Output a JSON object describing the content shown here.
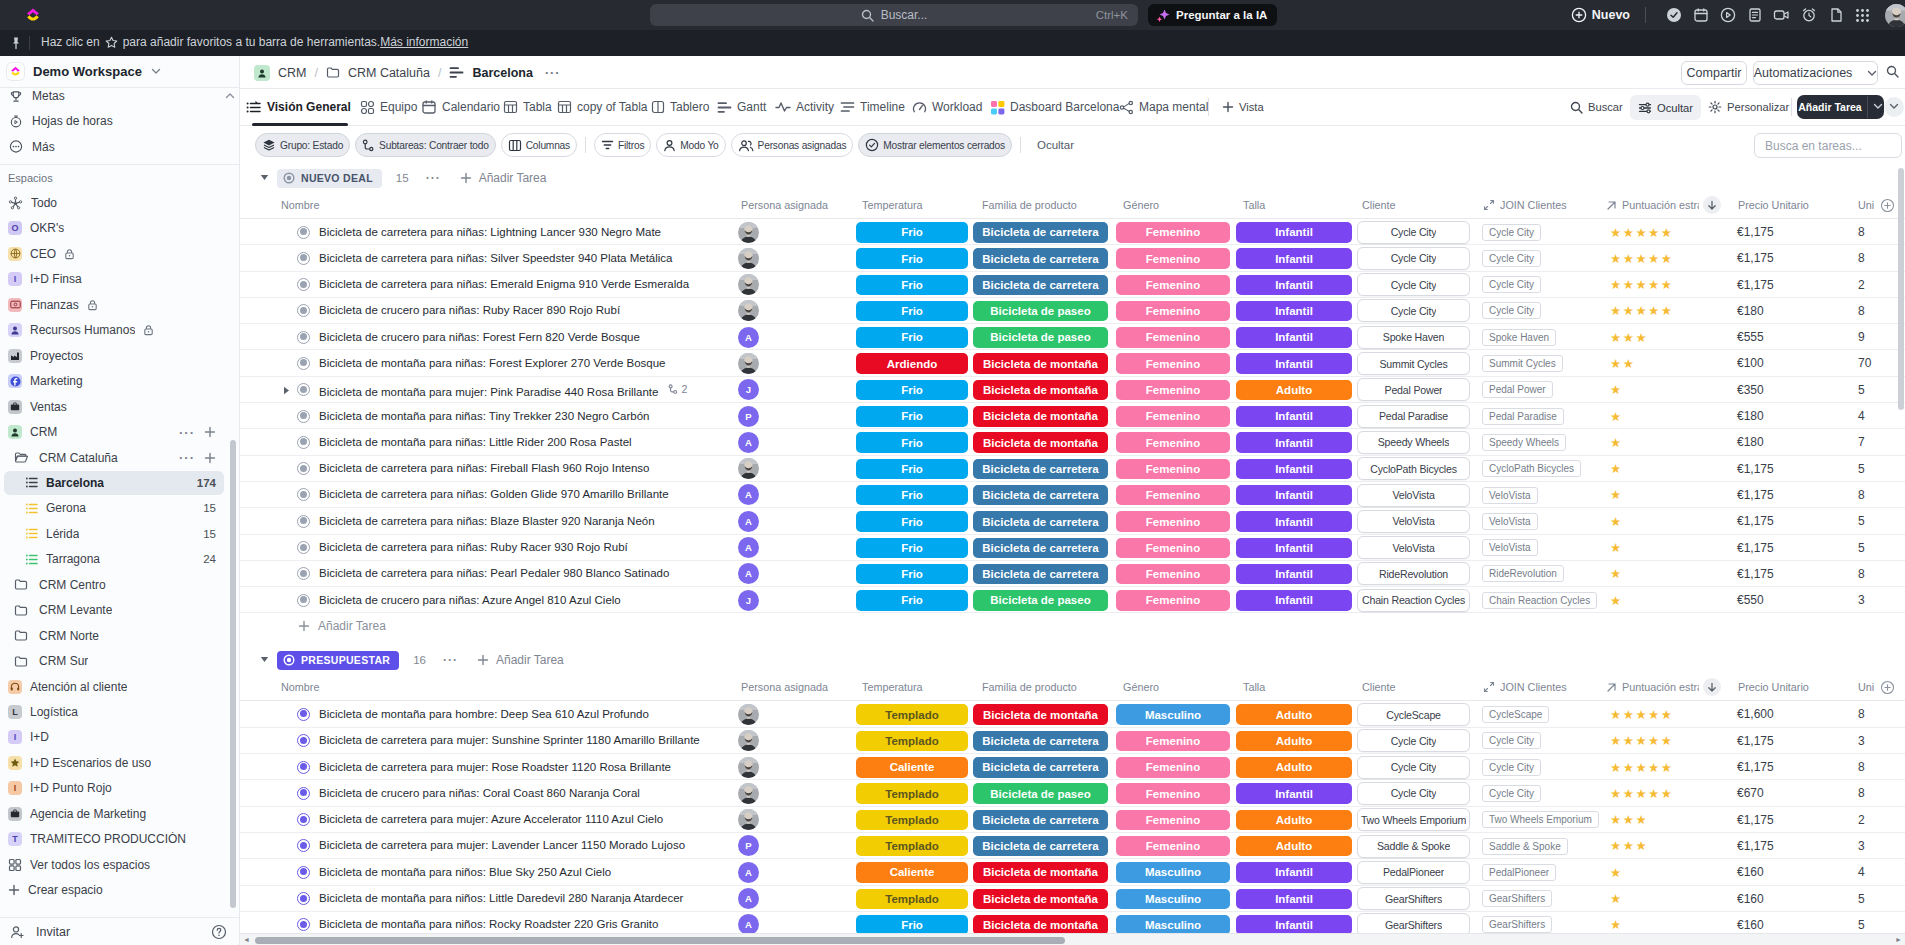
{
  "topbar": {
    "search_placeholder": "Buscar...",
    "search_shortcut": "Ctrl+K",
    "ask_ai_label": "Preguntar a la IA",
    "new_label": "Nuevo",
    "icons": [
      "check-circle-icon",
      "calendar-icon",
      "play-circle-icon",
      "notes-icon",
      "video-icon",
      "alarm-icon",
      "doc-icon",
      "apps-grid-icon",
      "avatar"
    ]
  },
  "favorites_bar": {
    "text_before_star": "Haz clic en",
    "text_after_star": "para añadir favoritos a tu barra de herramientas.",
    "link": "Más información"
  },
  "sidebar": {
    "workspace_name": "Demo Workspace",
    "nav": [
      {
        "label": "Metas",
        "icon": "trophy-icon"
      },
      {
        "label": "Hojas de horas",
        "icon": "stopwatch-icon"
      },
      {
        "label": "Más",
        "icon": "circle-ellipsis-icon"
      }
    ],
    "section_label": "Espacios",
    "items": [
      {
        "label": "Todo",
        "type": "space",
        "icon": "everything-icon"
      },
      {
        "label": "OKR's",
        "type": "space",
        "avatar": "O",
        "bg": "#cfc9f3",
        "fg": "#4f3fae"
      },
      {
        "label": "CEO",
        "type": "space",
        "avatar": "globe",
        "bg": "#f6dfa9",
        "fg": "#8a6a14",
        "lock": true
      },
      {
        "label": "I+D Finsa",
        "type": "space",
        "avatar": "I",
        "bg": "#d4cbf6",
        "fg": "#5a47c2"
      },
      {
        "label": "Finanzas",
        "type": "space",
        "avatar": "banknote",
        "bg": "#f2b9bd",
        "fg": "#8d2730",
        "lock": true
      },
      {
        "label": "Recursos Humanos",
        "type": "space",
        "avatar": "person",
        "bg": "#d6d2f8",
        "fg": "#3f3c8f",
        "lock": true
      },
      {
        "label": "Proyectos",
        "type": "space",
        "avatar": "factory",
        "bg": "#c7cacf",
        "fg": "#21242a"
      },
      {
        "label": "Marketing",
        "type": "space",
        "avatar": "fcircle",
        "bg": "#c9cdf9",
        "fg": "#3e4ed6"
      },
      {
        "label": "Ventas",
        "type": "space",
        "avatar": "briefcase",
        "bg": "#c3c6cb",
        "fg": "#26292f"
      },
      {
        "label": "CRM",
        "type": "space",
        "avatar": "person",
        "bg": "#bfe8cd",
        "fg": "#1f3a2c",
        "actions": true
      },
      {
        "label": "CRM Cataluña",
        "type": "folder",
        "icon": "folder-open-icon",
        "actions": true
      },
      {
        "label": "Barcelona",
        "type": "list",
        "icon": "list-icon",
        "icon_color": "#383f49",
        "count": "174",
        "selected": true
      },
      {
        "label": "Gerona",
        "type": "list",
        "icon": "list-icon",
        "icon_color": "#f4c430",
        "count": "15"
      },
      {
        "label": "Lérida",
        "type": "list",
        "icon": "list-icon",
        "icon_color": "#f4c430",
        "count": "15"
      },
      {
        "label": "Tarragona",
        "type": "list",
        "icon": "list-icon",
        "icon_color": "#3fc372",
        "count": "24"
      },
      {
        "label": "CRM Centro",
        "type": "folder",
        "icon": "folder-icon"
      },
      {
        "label": "CRM Levante",
        "type": "folder",
        "icon": "folder-icon"
      },
      {
        "label": "CRM Norte",
        "type": "folder",
        "icon": "folder-icon"
      },
      {
        "label": "CRM Sur",
        "type": "folder",
        "icon": "folder-icon"
      },
      {
        "label": "Atención al cliente",
        "type": "space",
        "avatar": "headset",
        "bg": "#f6cba7",
        "fg": "#7e4a12"
      },
      {
        "label": "Logística",
        "type": "space",
        "avatar": "L",
        "bg": "#c7cacf",
        "fg": "#33373e"
      },
      {
        "label": "I+D",
        "type": "space",
        "avatar": "I",
        "bg": "#d4cbf6",
        "fg": "#5a47c2"
      },
      {
        "label": "I+D Escenarios de uso",
        "type": "space",
        "avatar": "star",
        "bg": "#f6dfa9",
        "fg": "#6e5a10"
      },
      {
        "label": "I+D Punto Rojo",
        "type": "space",
        "avatar": "I",
        "bg": "#f5c9a4",
        "fg": "#a3431a"
      },
      {
        "label": "Agencia de Marketing",
        "type": "space",
        "avatar": "briefcase",
        "bg": "#c3c6cb",
        "fg": "#26292f"
      },
      {
        "label": "TRAMITECO PRODUCCIÓN",
        "type": "space",
        "avatar": "T",
        "bg": "#d6d2f8",
        "fg": "#4b3fb0"
      },
      {
        "label": "Ver todos los espacios",
        "type": "action",
        "icon": "grid-icon"
      },
      {
        "label": "Crear espacio",
        "type": "action",
        "icon": "plus-icon"
      }
    ],
    "invite_label": "Invitar"
  },
  "breadcrumb": {
    "space": "CRM",
    "folder": "CRM Cataluña",
    "list": "Barcelona"
  },
  "header_actions": {
    "share": "Compartir",
    "automations": "Automatizaciones"
  },
  "tabs": [
    {
      "label": "Visión General",
      "icon": "overview-icon",
      "active": true
    },
    {
      "label": "Equipo",
      "icon": "team-icon"
    },
    {
      "label": "Calendario",
      "icon": "calendar-icon"
    },
    {
      "label": "Tabla",
      "icon": "table-icon"
    },
    {
      "label": "copy of Tabla",
      "icon": "table-icon"
    },
    {
      "label": "Tablero",
      "icon": "board-icon"
    },
    {
      "label": "Gantt",
      "icon": "gantt-icon"
    },
    {
      "label": "Activity",
      "icon": "activity-icon"
    },
    {
      "label": "Timeline",
      "icon": "timeline-icon"
    },
    {
      "label": "Workload",
      "icon": "workload-icon"
    },
    {
      "label": "Dasboard Barcelona",
      "icon": "dashboard-icon"
    },
    {
      "label": "Mapa mental",
      "icon": "mindmap-icon"
    }
  ],
  "add_view_label": "Vista",
  "view_controls": {
    "search": "Buscar",
    "hide": "Ocultar",
    "customize": "Personalizar",
    "add_task": "Añadir Tarea"
  },
  "toolbar": {
    "pills": [
      {
        "label": "Grupo: Estado",
        "icon": "layers-icon",
        "filled": true
      },
      {
        "label": "Subtareas: Contraer todo",
        "icon": "subtask-icon",
        "filled": true
      },
      {
        "label": "Columnas",
        "icon": "columns-icon",
        "filled": false
      },
      {
        "label": "Filtros",
        "icon": "filter-icon",
        "filled": false
      },
      {
        "label": "Modo Yo",
        "icon": "user-icon",
        "filled": false
      },
      {
        "label": "Personas asignadas",
        "icon": "users-icon",
        "filled": false
      },
      {
        "label": "Mostrar elementos cerrados",
        "icon": "check-circle-icon",
        "filled": true
      }
    ],
    "hide_label": "Ocultar",
    "task_search_placeholder": "Busca en tareas..."
  },
  "table": {
    "columns": {
      "name": "Nombre",
      "assignee": "Persona asignada",
      "temperature": "Temperatura",
      "family": "Familia de producto",
      "gender": "Género",
      "size": "Talla",
      "client": "Cliente",
      "join": "JOIN Clientes",
      "score": "Puntuación estraté...",
      "price": "Precio Unitario",
      "units": "Uni"
    },
    "add_task_label": "Añadir Tarea",
    "groups": [
      {
        "status": "NUEVO DEAL",
        "pill_bg": "#e7eaf1",
        "pill_fg": "#47536a",
        "dot_color": "#8b94a3",
        "count": "15",
        "rows": [
          {
            "name": "Bicicleta de carretera para niñas: Lightning Lancer 930 Negro Mate",
            "assignee": "photo",
            "temperature": "Frio",
            "family": "Bicicleta de carretera",
            "gender": "Femenino",
            "size": "Infantil",
            "client": "Cycle City",
            "join": "Cycle City",
            "stars": 5,
            "price": "€1,175",
            "units": "8"
          },
          {
            "name": "Bicicleta de carretera para niñas: Silver Speedster 940 Plata Metálica",
            "assignee": "photo",
            "temperature": "Frio",
            "family": "Bicicleta de carretera",
            "gender": "Femenino",
            "size": "Infantil",
            "client": "Cycle City",
            "join": "Cycle City",
            "stars": 5,
            "price": "€1,175",
            "units": "8"
          },
          {
            "name": "Bicicleta de carretera para niñas: Emerald Enigma 910 Verde Esmeralda",
            "assignee": "photo",
            "temperature": "Frio",
            "family": "Bicicleta de carretera",
            "gender": "Femenino",
            "size": "Infantil",
            "client": "Cycle City",
            "join": "Cycle City",
            "stars": 5,
            "price": "€1,175",
            "units": "2"
          },
          {
            "name": "Bicicleta de crucero para niñas: Ruby Racer 890 Rojo Rubí",
            "assignee": "photo",
            "temperature": "Frio",
            "family": "Bicicleta de paseo",
            "gender": "Femenino",
            "size": "Infantil",
            "client": "Cycle City",
            "join": "Cycle City",
            "stars": 5,
            "price": "€180",
            "units": "8"
          },
          {
            "name": "Bicicleta de crucero para niñas: Forest Fern 820 Verde Bosque",
            "assignee": "A",
            "temperature": "Frio",
            "family": "Bicicleta de paseo",
            "gender": "Femenino",
            "size": "Infantil",
            "client": "Spoke Haven",
            "join": "Spoke Haven",
            "stars": 3,
            "price": "€555",
            "units": "9"
          },
          {
            "name": "Bicicleta de montaña para niñas: Forest Explorer 270 Verde Bosque",
            "assignee": "photo",
            "temperature": "Ardiendo",
            "family": "Bicicleta de montaña",
            "gender": "Femenino",
            "size": "Infantil",
            "client": "Summit Cycles",
            "join": "Summit Cycles",
            "stars": 2,
            "price": "€100",
            "units": "70"
          },
          {
            "name": "Bicicleta de montaña para mujer: Pink Paradise 440 Rosa Brillante",
            "assignee": "J",
            "temperature": "Frio",
            "family": "Bicicleta de montaña",
            "gender": "Femenino",
            "size": "Adulto",
            "client": "Pedal Power",
            "join": "Pedal Power",
            "stars": 1,
            "price": "€350",
            "units": "5",
            "expandable": true,
            "subtasks": "2"
          },
          {
            "name": "Bicicleta de montaña para niñas: Tiny Trekker 230 Negro Carbón",
            "assignee": "P",
            "temperature": "Frio",
            "family": "Bicicleta de montaña",
            "gender": "Femenino",
            "size": "Infantil",
            "client": "Pedal Paradise",
            "join": "Pedal Paradise",
            "stars": 1,
            "price": "€180",
            "units": "4"
          },
          {
            "name": "Bicicleta de montaña para niñas: Little Rider 200 Rosa Pastel",
            "assignee": "A",
            "temperature": "Frio",
            "family": "Bicicleta de montaña",
            "gender": "Femenino",
            "size": "Infantil",
            "client": "Speedy Wheels",
            "join": "Speedy Wheels",
            "stars": 1,
            "price": "€180",
            "units": "7"
          },
          {
            "name": "Bicicleta de carretera para niñas: Fireball Flash 960 Rojo Intenso",
            "assignee": "photo",
            "temperature": "Frio",
            "family": "Bicicleta de carretera",
            "gender": "Femenino",
            "size": "Infantil",
            "client": "CycloPath Bicycles",
            "join": "CycloPath Bicycles",
            "stars": 1,
            "price": "€1,175",
            "units": "5"
          },
          {
            "name": "Bicicleta de carretera para niñas: Golden Glide 970 Amarillo Brillante",
            "assignee": "A",
            "temperature": "Frio",
            "family": "Bicicleta de carretera",
            "gender": "Femenino",
            "size": "Infantil",
            "client": "VeloVista",
            "join": "VeloVista",
            "stars": 1,
            "price": "€1,175",
            "units": "8"
          },
          {
            "name": "Bicicleta de carretera para niñas: Blaze Blaster 920 Naranja Neón",
            "assignee": "A",
            "temperature": "Frio",
            "family": "Bicicleta de carretera",
            "gender": "Femenino",
            "size": "Infantil",
            "client": "VeloVista",
            "join": "VeloVista",
            "stars": 1,
            "price": "€1,175",
            "units": "5"
          },
          {
            "name": "Bicicleta de carretera para niñas: Ruby Racer 930 Rojo Rubí",
            "assignee": "A",
            "temperature": "Frio",
            "family": "Bicicleta de carretera",
            "gender": "Femenino",
            "size": "Infantil",
            "client": "VeloVista",
            "join": "VeloVista",
            "stars": 1,
            "price": "€1,175",
            "units": "5"
          },
          {
            "name": "Bicicleta de carretera para niñas: Pearl Pedaler 980 Blanco Satinado",
            "assignee": "A",
            "temperature": "Frio",
            "family": "Bicicleta de carretera",
            "gender": "Femenino",
            "size": "Infantil",
            "client": "RideRevolution",
            "join": "RideRevolution",
            "stars": 1,
            "price": "€1,175",
            "units": "8"
          },
          {
            "name": "Bicicleta de crucero para niñas: Azure Angel 810 Azul Cielo",
            "assignee": "J",
            "temperature": "Frio",
            "family": "Bicicleta de paseo",
            "gender": "Femenino",
            "size": "Infantil",
            "client": "Chain Reaction Cycles",
            "join": "Chain Reaction Cycles",
            "stars": 1,
            "price": "€550",
            "units": "3"
          }
        ]
      },
      {
        "status": "PRESUPUESTAR",
        "pill_bg": "#5d4fe8",
        "pill_fg": "#ffffff",
        "dot_color": "#5d4fe8",
        "count": "16",
        "rows": [
          {
            "name": "Bicicleta de montaña para hombre: Deep Sea 610 Azul Profundo",
            "assignee": "photo",
            "temperature": "Templado",
            "family": "Bicicleta de montaña",
            "gender": "Masculino",
            "size": "Adulto",
            "client": "CycleScape",
            "join": "CycleScape",
            "stars": 5,
            "price": "€1,600",
            "units": "8"
          },
          {
            "name": "Bicicleta de carretera para mujer: Sunshine Sprinter 1180 Amarillo Brillante",
            "assignee": "photo",
            "temperature": "Templado",
            "family": "Bicicleta de carretera",
            "gender": "Femenino",
            "size": "Adulto",
            "client": "Cycle City",
            "join": "Cycle City",
            "stars": 5,
            "price": "€1,175",
            "units": "3"
          },
          {
            "name": "Bicicleta de carretera para mujer: Rose Roadster 1120 Rosa Brillante",
            "assignee": "photo",
            "temperature": "Caliente",
            "family": "Bicicleta de carretera",
            "gender": "Femenino",
            "size": "Adulto",
            "client": "Cycle City",
            "join": "Cycle City",
            "stars": 5,
            "price": "€1,175",
            "units": "8"
          },
          {
            "name": "Bicicleta de crucero para niñas: Coral Coast 860 Naranja Coral",
            "assignee": "photo",
            "temperature": "Templado",
            "family": "Bicicleta de paseo",
            "gender": "Femenino",
            "size": "Infantil",
            "client": "Cycle City",
            "join": "Cycle City",
            "stars": 5,
            "price": "€670",
            "units": "8"
          },
          {
            "name": "Bicicleta de carretera para mujer: Azure Accelerator 1110 Azul Cielo",
            "assignee": "photo",
            "temperature": "Templado",
            "family": "Bicicleta de carretera",
            "gender": "Femenino",
            "size": "Adulto",
            "client": "Two Wheels Emporium",
            "join": "Two Wheels Emporium",
            "stars": 3,
            "price": "€1,175",
            "units": "2"
          },
          {
            "name": "Bicicleta de carretera para mujer: Lavender Lancer 1150 Morado Lujoso",
            "assignee": "P",
            "temperature": "Templado",
            "family": "Bicicleta de carretera",
            "gender": "Femenino",
            "size": "Adulto",
            "client": "Saddle & Spoke",
            "join": "Saddle & Spoke",
            "stars": 3,
            "price": "€1,175",
            "units": "3"
          },
          {
            "name": "Bicicleta de montaña para niños: Blue Sky 250 Azul Cielo",
            "assignee": "A",
            "temperature": "Caliente",
            "family": "Bicicleta de montaña",
            "gender": "Masculino",
            "size": "Infantil",
            "client": "PedalPioneer",
            "join": "PedalPioneer",
            "stars": 1,
            "price": "€160",
            "units": "4"
          },
          {
            "name": "Bicicleta de montaña para niños: Little Daredevil 280 Naranja Atardecer",
            "assignee": "A",
            "temperature": "Templado",
            "family": "Bicicleta de montaña",
            "gender": "Masculino",
            "size": "Infantil",
            "client": "GearShifters",
            "join": "GearShifters",
            "stars": 1,
            "price": "€160",
            "units": "5"
          },
          {
            "name": "Bicicleta de montaña para niños: Rocky Roadster 220 Gris Granito",
            "assignee": "A",
            "temperature": "Frio",
            "family": "Bicicleta de montaña",
            "gender": "Masculino",
            "size": "Infantil",
            "client": "GearShifters",
            "join": "GearShifters",
            "stars": 1,
            "price": "€160",
            "units": "5"
          }
        ]
      }
    ]
  },
  "colors": {
    "temperature": {
      "Frio": "#00a8f0",
      "Templado": "#f2cd02",
      "Caliente": "#fd7e11",
      "Ardiendo": "#e80a22"
    },
    "temperature_text": {
      "Templado": "#5d561f"
    },
    "family": {
      "Bicicleta de carretera": "#3879ab",
      "Bicicleta de montaña": "#e80a22",
      "Bicicleta de paseo": "#2cc56c"
    },
    "gender": {
      "Femenino": "#fa78a9",
      "Masculino": "#3d9ce1"
    },
    "size": {
      "Infantil": "#7b45f2",
      "Adulto": "#fd7e11"
    },
    "star": "#f6bb34",
    "initial_avatar": "#7b68ee"
  }
}
